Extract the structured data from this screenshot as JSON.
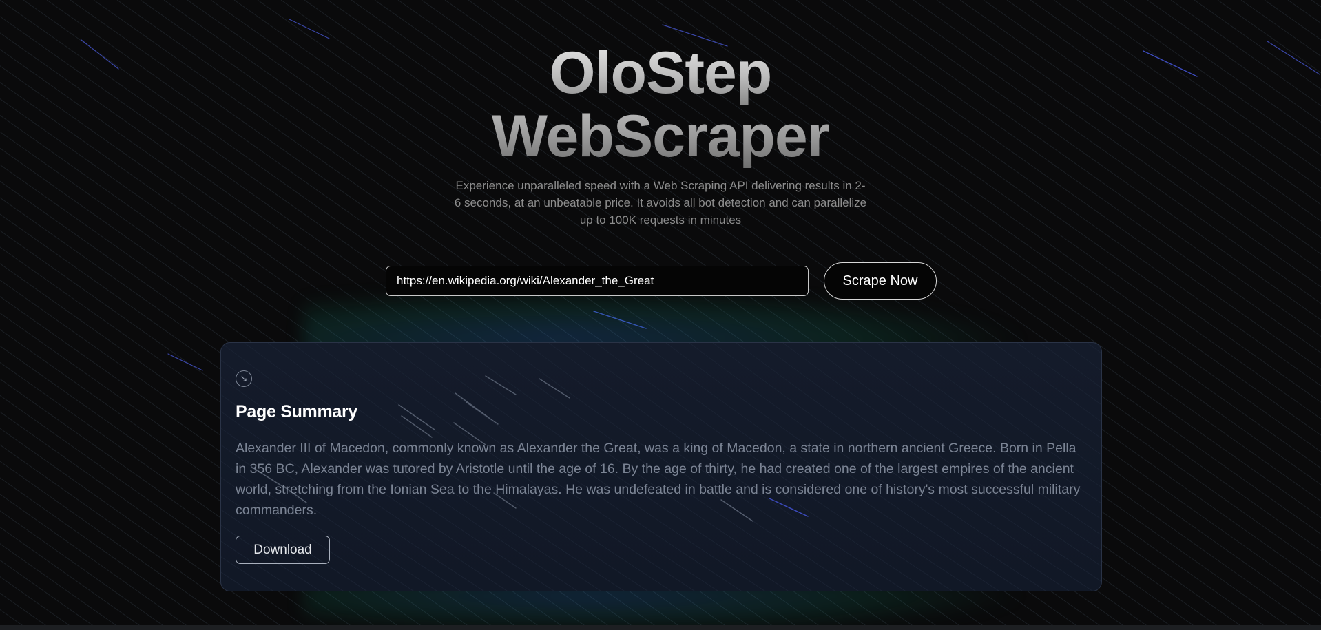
{
  "hero": {
    "title_line1": "OloStep",
    "title_line2": "WebScraper",
    "subtitle": "Experience unparalleled speed with a Web Scraping API delivering results in 2-6 seconds, at an unbeatable price. It avoids all bot detection and can parallelize up to 100K requests in minutes"
  },
  "search": {
    "value": "https://en.wikipedia.org/wiki/Alexander_the_Great",
    "button_label": "Scrape Now"
  },
  "summary_card": {
    "icon": "arrow-down-right-icon",
    "heading": "Page Summary",
    "body": "Alexander III of Macedon, commonly known as Alexander the Great, was a king of Macedon, a state in northern ancient Greece. Born in Pella in 356 BC, Alexander was tutored by Aristotle until the age of 16. By the age of thirty, he had created one of the largest empires of the ancient world, stretching from the Ionian Sea to the Himalayas. He was undefeated in battle and is considered one of history's most successful military commanders.",
    "download_label": "Download"
  },
  "colors": {
    "background": "#0a0a0b",
    "card_background": "#141b2a",
    "card_border": "#2a3346",
    "accent_blue": "#3b5bd6",
    "accent_green": "#14a37f",
    "body_text": "#7b8494"
  }
}
